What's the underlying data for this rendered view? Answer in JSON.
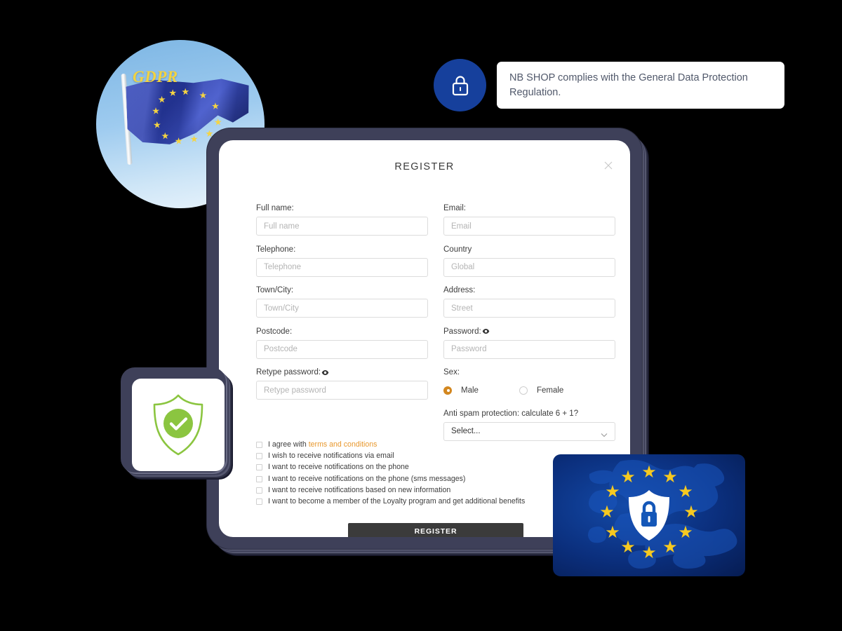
{
  "tooltip": {
    "text": "NB SHOP complies with the General Data Protection Regulation.",
    "icon": "lock-icon",
    "circle_color": "#16409c"
  },
  "flag_image": {
    "flag_text": "GDPR",
    "alt": "EU flag with GDPR text against blue sky"
  },
  "shield_badge": {
    "icon": "shield-check-icon",
    "color": "#8bc540"
  },
  "eu_card": {
    "icon": "shield-lock-icon",
    "star_count": 12,
    "star_color": "#f6c921",
    "background_color": "#0b2f7d",
    "alt": "Europe map with EU stars and security shield"
  },
  "modal": {
    "title": "REGISTER",
    "close_label": "×",
    "fields": [
      {
        "label": "Full name:",
        "placeholder": "Full name",
        "value": "",
        "name": "full-name"
      },
      {
        "label": "Email:",
        "placeholder": "Email",
        "value": "",
        "name": "email"
      },
      {
        "label": "Telephone:",
        "placeholder": "Telephone",
        "value": "",
        "name": "telephone"
      },
      {
        "label": "Country",
        "placeholder": "Global",
        "value": "",
        "name": "country"
      },
      {
        "label": "Town/City:",
        "placeholder": "Town/City",
        "value": "",
        "name": "town-city"
      },
      {
        "label": "Address:",
        "placeholder": "Street",
        "value": "",
        "name": "address"
      },
      {
        "label": "Postcode:",
        "placeholder": "Postcode",
        "value": "",
        "name": "postcode"
      },
      {
        "label": "Password:",
        "placeholder": "Password",
        "value": "",
        "name": "password",
        "has_eye": true
      },
      {
        "label": "Retype password:",
        "placeholder": "Retype password",
        "value": "",
        "name": "retype-password",
        "has_eye": true
      }
    ],
    "sex": {
      "label": "Sex:",
      "options": [
        {
          "label": "Male",
          "selected": true
        },
        {
          "label": "Female",
          "selected": false
        }
      ],
      "selected_color": "#d3871f"
    },
    "captcha": {
      "label": "Anti spam protection: calculate 6 + 1?",
      "selected_option": "Select...",
      "chevron": "chevron-down-icon"
    },
    "checkboxes": [
      {
        "prefix": "I agree with ",
        "link": "terms and conditions",
        "checked": false
      },
      {
        "prefix": "I wish to receive notifications via email",
        "link": "",
        "checked": false
      },
      {
        "prefix": "I want to receive notifications on the phone",
        "link": "",
        "checked": false
      },
      {
        "prefix": "I want to receive notifications on the phone (sms messages)",
        "link": "",
        "checked": false
      },
      {
        "prefix": "I want to receive notifications based on new information",
        "link": "",
        "checked": false
      },
      {
        "prefix": "I want to become a member of the Loyalty program and get additional benefits",
        "link": "",
        "checked": false
      }
    ],
    "link_color": "#e8982e",
    "submit_label": "REGISTER",
    "submit_color": "#3b3b3b"
  }
}
